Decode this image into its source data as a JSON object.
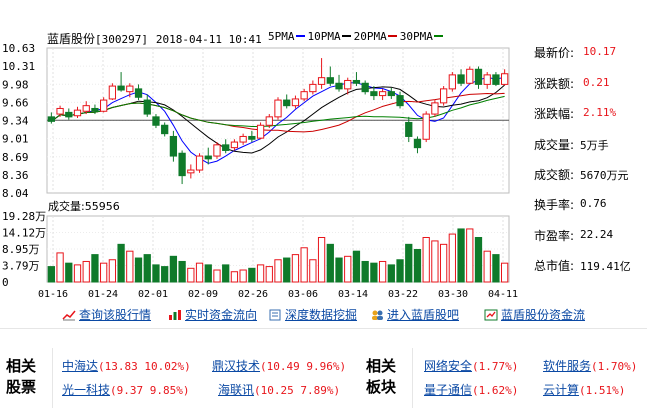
{
  "header": {
    "name": "蓝盾股份",
    "code": "[300297]",
    "datetime": "2018-04-11  10:41",
    "ma_labels": [
      "5PMA",
      "10PMA",
      "20PMA",
      "30PMA"
    ],
    "ma_colors": [
      "#000000",
      "#0000ff",
      "#000000",
      "#cc0000",
      "#008000"
    ]
  },
  "stats": [
    {
      "label": "最新价:",
      "value": "10.17"
    },
    {
      "label": "涨跌额:",
      "value": "0.21"
    },
    {
      "label": "涨跌幅:",
      "value": "2.11%"
    },
    {
      "label": "成交量:",
      "value": "5万手"
    },
    {
      "label": "成交额:",
      "value": "5670万元"
    },
    {
      "label": "换手率:",
      "value": "0.76"
    },
    {
      "label": "市盈率:",
      "value": "22.24"
    },
    {
      "label": "总市值:",
      "value": "119.41亿"
    }
  ],
  "chart_data": [
    {
      "type": "candlestick",
      "y_ticks": [
        "10.63",
        "10.31",
        "9.98",
        "9.66",
        "9.34",
        "9.01",
        "8.69",
        "8.36",
        "8.04"
      ],
      "ylim": [
        8.04,
        10.63
      ],
      "x_ticks": [
        "01-16",
        "01-24",
        "02-01",
        "02-09",
        "02-26",
        "03-06",
        "03-14",
        "03-22",
        "03-30",
        "04-11"
      ],
      "reference_line": 9.34,
      "colors": {
        "up": "#e8151b",
        "down": "#0f7a2a"
      },
      "candles": [
        {
          "o": 9.4,
          "h": 9.48,
          "l": 9.28,
          "c": 9.32
        },
        {
          "o": 9.45,
          "h": 9.6,
          "l": 9.4,
          "c": 9.55
        },
        {
          "o": 9.48,
          "h": 9.55,
          "l": 9.35,
          "c": 9.4
        },
        {
          "o": 9.42,
          "h": 9.58,
          "l": 9.38,
          "c": 9.52
        },
        {
          "o": 9.5,
          "h": 9.68,
          "l": 9.45,
          "c": 9.6
        },
        {
          "o": 9.55,
          "h": 9.62,
          "l": 9.45,
          "c": 9.5
        },
        {
          "o": 9.5,
          "h": 9.75,
          "l": 9.48,
          "c": 9.7
        },
        {
          "o": 9.72,
          "h": 10.0,
          "l": 9.7,
          "c": 9.95
        },
        {
          "o": 9.95,
          "h": 10.2,
          "l": 9.85,
          "c": 9.88
        },
        {
          "o": 9.85,
          "h": 10.0,
          "l": 9.75,
          "c": 9.95
        },
        {
          "o": 9.9,
          "h": 9.98,
          "l": 9.7,
          "c": 9.75
        },
        {
          "o": 9.7,
          "h": 9.8,
          "l": 9.4,
          "c": 9.45
        },
        {
          "o": 9.4,
          "h": 9.45,
          "l": 9.2,
          "c": 9.25
        },
        {
          "o": 9.25,
          "h": 9.3,
          "l": 9.05,
          "c": 9.1
        },
        {
          "o": 9.05,
          "h": 9.15,
          "l": 8.6,
          "c": 8.7
        },
        {
          "o": 8.75,
          "h": 8.8,
          "l": 8.2,
          "c": 8.35
        },
        {
          "o": 8.4,
          "h": 8.55,
          "l": 8.3,
          "c": 8.45
        },
        {
          "o": 8.45,
          "h": 8.75,
          "l": 8.4,
          "c": 8.7
        },
        {
          "o": 8.7,
          "h": 8.85,
          "l": 8.55,
          "c": 8.65
        },
        {
          "o": 8.7,
          "h": 8.95,
          "l": 8.65,
          "c": 8.9
        },
        {
          "o": 8.9,
          "h": 9.0,
          "l": 8.75,
          "c": 8.8
        },
        {
          "o": 8.85,
          "h": 9.0,
          "l": 8.8,
          "c": 8.95
        },
        {
          "o": 8.95,
          "h": 9.1,
          "l": 8.9,
          "c": 9.05
        },
        {
          "o": 9.05,
          "h": 9.15,
          "l": 8.95,
          "c": 9.0
        },
        {
          "o": 9.02,
          "h": 9.3,
          "l": 9.0,
          "c": 9.25
        },
        {
          "o": 9.25,
          "h": 9.45,
          "l": 9.2,
          "c": 9.4
        },
        {
          "o": 9.4,
          "h": 9.75,
          "l": 9.35,
          "c": 9.7
        },
        {
          "o": 9.7,
          "h": 9.8,
          "l": 9.55,
          "c": 9.6
        },
        {
          "o": 9.6,
          "h": 9.78,
          "l": 9.55,
          "c": 9.72
        },
        {
          "o": 9.72,
          "h": 9.9,
          "l": 9.68,
          "c": 9.85
        },
        {
          "o": 9.85,
          "h": 10.05,
          "l": 9.8,
          "c": 9.98
        },
        {
          "o": 9.98,
          "h": 10.45,
          "l": 9.9,
          "c": 10.1
        },
        {
          "o": 10.1,
          "h": 10.3,
          "l": 9.95,
          "c": 10.0
        },
        {
          "o": 10.0,
          "h": 10.15,
          "l": 9.85,
          "c": 9.9
        },
        {
          "o": 9.9,
          "h": 10.1,
          "l": 9.8,
          "c": 10.05
        },
        {
          "o": 10.05,
          "h": 10.2,
          "l": 9.95,
          "c": 10.0
        },
        {
          "o": 10.0,
          "h": 10.05,
          "l": 9.8,
          "c": 9.85
        },
        {
          "o": 9.85,
          "h": 9.95,
          "l": 9.7,
          "c": 9.78
        },
        {
          "o": 9.78,
          "h": 9.9,
          "l": 9.7,
          "c": 9.85
        },
        {
          "o": 9.85,
          "h": 9.92,
          "l": 9.72,
          "c": 9.78
        },
        {
          "o": 9.78,
          "h": 9.85,
          "l": 9.55,
          "c": 9.6
        },
        {
          "o": 9.3,
          "h": 9.4,
          "l": 8.95,
          "c": 9.05
        },
        {
          "o": 9.0,
          "h": 9.05,
          "l": 8.75,
          "c": 8.85
        },
        {
          "o": 9.0,
          "h": 9.5,
          "l": 8.95,
          "c": 9.45
        },
        {
          "o": 9.45,
          "h": 9.7,
          "l": 9.4,
          "c": 9.65
        },
        {
          "o": 9.65,
          "h": 9.95,
          "l": 9.6,
          "c": 9.9
        },
        {
          "o": 9.9,
          "h": 10.2,
          "l": 9.85,
          "c": 10.15
        },
        {
          "o": 10.15,
          "h": 10.25,
          "l": 9.95,
          "c": 10.0
        },
        {
          "o": 10.0,
          "h": 10.3,
          "l": 9.98,
          "c": 10.25
        },
        {
          "o": 10.25,
          "h": 10.3,
          "l": 9.9,
          "c": 9.98
        },
        {
          "o": 9.98,
          "h": 10.2,
          "l": 9.9,
          "c": 10.15
        },
        {
          "o": 10.15,
          "h": 10.2,
          "l": 9.95,
          "c": 9.98
        },
        {
          "o": 9.98,
          "h": 10.25,
          "l": 9.96,
          "c": 10.17
        }
      ]
    },
    {
      "type": "bar",
      "title": "成交量:55956",
      "y_ticks": [
        "19.28万",
        "14.12万",
        "8.95万",
        "3.79万",
        "0"
      ],
      "ylim": [
        0,
        19.28
      ],
      "values": [
        4.5,
        8.5,
        5.5,
        5.0,
        6.0,
        8.0,
        5.5,
        6.5,
        11.0,
        9.0,
        7.0,
        8.0,
        5.0,
        4.5,
        7.5,
        6.0,
        4.0,
        5.5,
        5.0,
        3.5,
        5.0,
        3.0,
        3.5,
        4.0,
        5.0,
        4.5,
        6.5,
        7.0,
        8.0,
        10.0,
        6.5,
        13.0,
        11.0,
        7.0,
        7.5,
        9.0,
        6.0,
        5.5,
        6.0,
        5.0,
        6.5,
        11.0,
        9.5,
        13.0,
        12.0,
        11.0,
        14.0,
        15.5,
        15.5,
        13.0,
        9.0,
        8.0,
        5.5
      ],
      "colors": {
        "up": "#e8151b",
        "down": "#0f7a2a"
      }
    }
  ],
  "links": [
    {
      "label": "查询该股行情",
      "icon": "chart-line-icon"
    },
    {
      "label": "实时资金流向",
      "icon": "bar-chart-icon"
    },
    {
      "label": "深度数据挖掘",
      "icon": "document-icon"
    },
    {
      "label": "进入蓝盾股吧",
      "icon": "people-icon"
    },
    {
      "label": "蓝盾股份资金流",
      "icon": "flow-icon"
    }
  ],
  "related_stocks": {
    "heading_line1": "相关",
    "heading_line2": "股票",
    "items": [
      {
        "name": "中海达",
        "value": "(13.83 10.02%)"
      },
      {
        "name": "鼎汉技术",
        "value": "(10.49 9.96%)"
      },
      {
        "name": "光一科技",
        "value": "(9.37 9.85%)"
      },
      {
        "name": "海联讯",
        "value": "(10.25 7.89%)"
      }
    ]
  },
  "related_sectors": {
    "heading_line1": "相关",
    "heading_line2": "板块",
    "items": [
      {
        "name": "网络安全",
        "value": "(1.77%)"
      },
      {
        "name": "软件服务",
        "value": "(1.70%)"
      },
      {
        "name": "量子通信",
        "value": "(1.62%)"
      },
      {
        "name": "云计算",
        "value": "(1.51%)"
      }
    ]
  }
}
